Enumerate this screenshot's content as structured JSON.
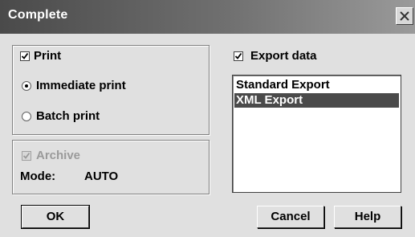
{
  "dialog": {
    "title": "Complete"
  },
  "print_group": {
    "print_label": "Print",
    "print_checked": true,
    "immediate_label": "Immediate print",
    "immediate_selected": true,
    "batch_label": "Batch print",
    "batch_selected": false
  },
  "archive_group": {
    "archive_label": "Archive",
    "archive_checked": true,
    "archive_enabled": false,
    "mode_label": "Mode:",
    "mode_value": "AUTO"
  },
  "export": {
    "label": "Export data",
    "checked": true,
    "items": [
      {
        "label": "Standard Export",
        "selected": false
      },
      {
        "label": "XML Export",
        "selected": true
      }
    ]
  },
  "buttons": {
    "ok": "OK",
    "cancel": "Cancel",
    "help": "Help"
  },
  "icons": {
    "close": "close-icon",
    "check": "checkmark-icon"
  },
  "colors": {
    "titlebar_start": "#4a4a4a",
    "titlebar_end": "#9a9a9a",
    "selection": "#4a4a4a",
    "dialog_bg": "#e0e0e0"
  }
}
